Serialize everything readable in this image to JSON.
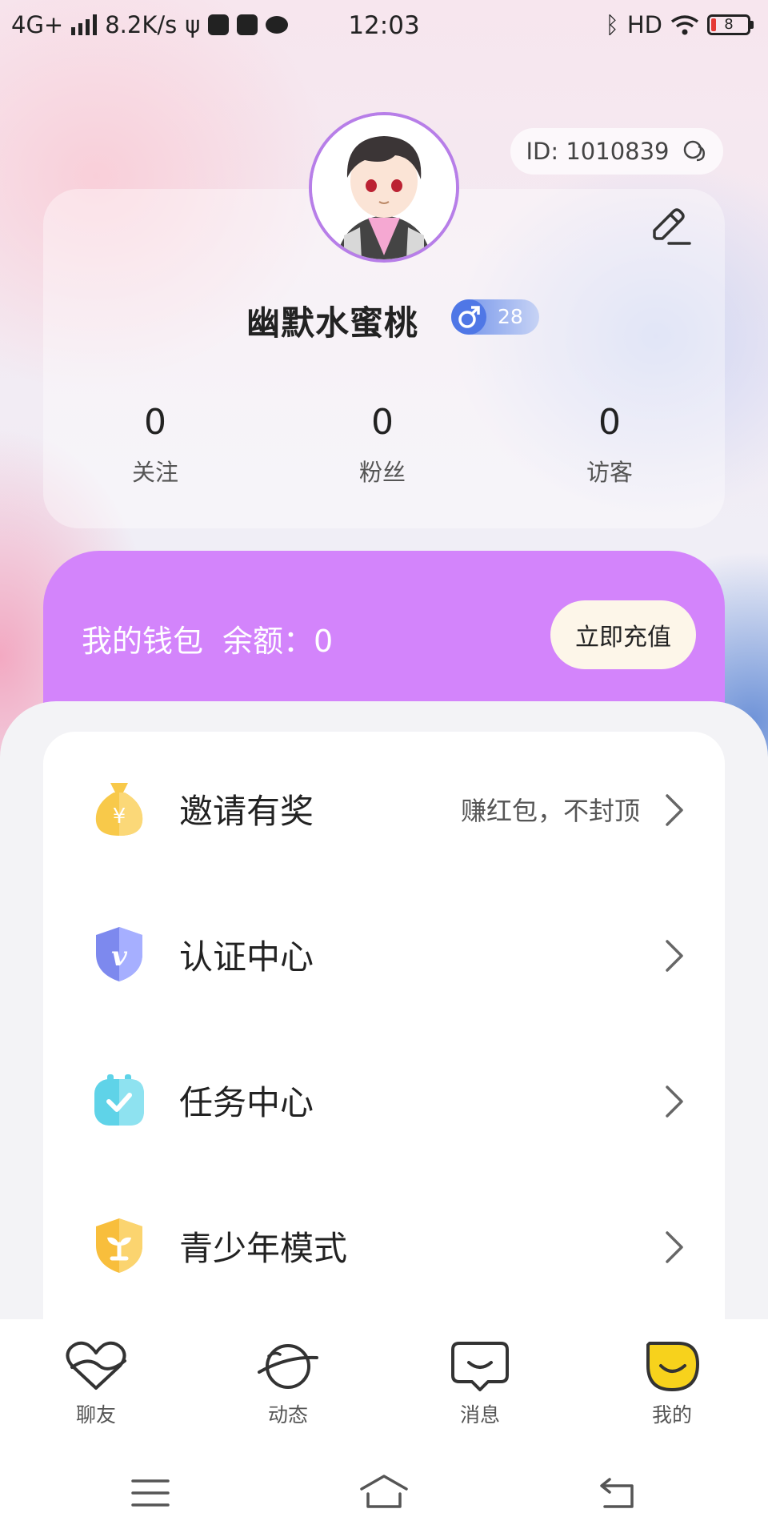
{
  "status_bar": {
    "network": "4G+",
    "speed": "8.2K/s",
    "time": "12:03",
    "hd": "HD",
    "battery": "8"
  },
  "profile": {
    "id_label": "ID: 1010839",
    "username": "幽默水蜜桃",
    "age": "28",
    "stats": [
      {
        "value": "0",
        "label": "关注"
      },
      {
        "value": "0",
        "label": "粉丝"
      },
      {
        "value": "0",
        "label": "访客"
      }
    ]
  },
  "wallet": {
    "title": "我的钱包",
    "balance_label": "余额：0",
    "recharge_button": "立即充值"
  },
  "menu": [
    {
      "label": "邀请有奖",
      "hint": "赚红包，不封顶",
      "icon": "money-bag-icon"
    },
    {
      "label": "认证中心",
      "hint": "",
      "icon": "verified-shield-icon"
    },
    {
      "label": "任务中心",
      "hint": "",
      "icon": "task-check-icon"
    },
    {
      "label": "青少年模式",
      "hint": "",
      "icon": "youth-shield-icon"
    }
  ],
  "tabs": [
    {
      "label": "聊友",
      "icon": "heart-icon"
    },
    {
      "label": "动态",
      "icon": "planet-icon"
    },
    {
      "label": "消息",
      "icon": "message-icon"
    },
    {
      "label": "我的",
      "icon": "smile-icon",
      "active": true
    }
  ],
  "colors": {
    "wallet_bg": "#d384fb",
    "avatar_ring": "#b77ee8",
    "gender_badge": "#4f77e6",
    "active_tab": "#f7d21c"
  }
}
